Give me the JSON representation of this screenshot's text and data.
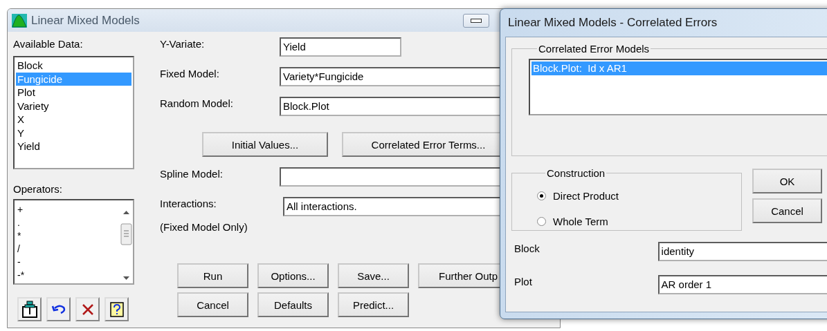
{
  "main_window": {
    "title": "Linear Mixed Models",
    "available_data": {
      "label": "Available Data:",
      "items": [
        {
          "text": "Block",
          "selected": false
        },
        {
          "text": "Fungicide",
          "selected": true
        },
        {
          "text": "Plot",
          "selected": false
        },
        {
          "text": "Variety",
          "selected": false
        },
        {
          "text": "X",
          "selected": false
        },
        {
          "text": "Y",
          "selected": false
        },
        {
          "text": "Yield",
          "selected": false
        }
      ]
    },
    "operators": {
      "label": "Operators:",
      "items": [
        "+",
        ".",
        "*",
        "/",
        "-",
        "-*"
      ]
    },
    "toolbar": [
      {
        "kind": "pin"
      },
      {
        "kind": "undo"
      },
      {
        "kind": "clear"
      },
      {
        "kind": "help"
      }
    ],
    "model_fields": [
      {
        "label": "Y-Variate:",
        "value": "Yield"
      },
      {
        "label": "Fixed Model:",
        "value": "Variety*Fungicide"
      },
      {
        "label": "Random Model:",
        "value": "Block.Plot"
      }
    ],
    "term_buttons": [
      "Initial Values...",
      "Correlated Error Terms..."
    ],
    "spline_model": {
      "label": "Spline Model:"
    },
    "interactions": {
      "label": "Interactions:",
      "value": "All interactions.",
      "note": "(Fixed Model Only)"
    },
    "action_buttons": [
      [
        "Run",
        "Options...",
        "Save...",
        "Further Outp"
      ],
      [
        "Cancel",
        "Defaults",
        "Predict..."
      ]
    ]
  },
  "dialog": {
    "title": "Linear Mixed Models - Correlated Errors",
    "error_models": {
      "label": "Correlated Error Models",
      "items": [
        {
          "text": "Block.Plot:  Id x AR1",
          "selected": true
        }
      ]
    },
    "construction": {
      "label": "Construction",
      "options": [
        {
          "text": "Direct Product",
          "selected": true
        },
        {
          "text": "Whole Term",
          "selected": false
        }
      ]
    },
    "buttons": [
      "OK",
      "Cancel"
    ],
    "terms": [
      {
        "label": "Block",
        "value": "identity"
      },
      {
        "label": "Plot",
        "value": "AR order 1"
      }
    ]
  }
}
